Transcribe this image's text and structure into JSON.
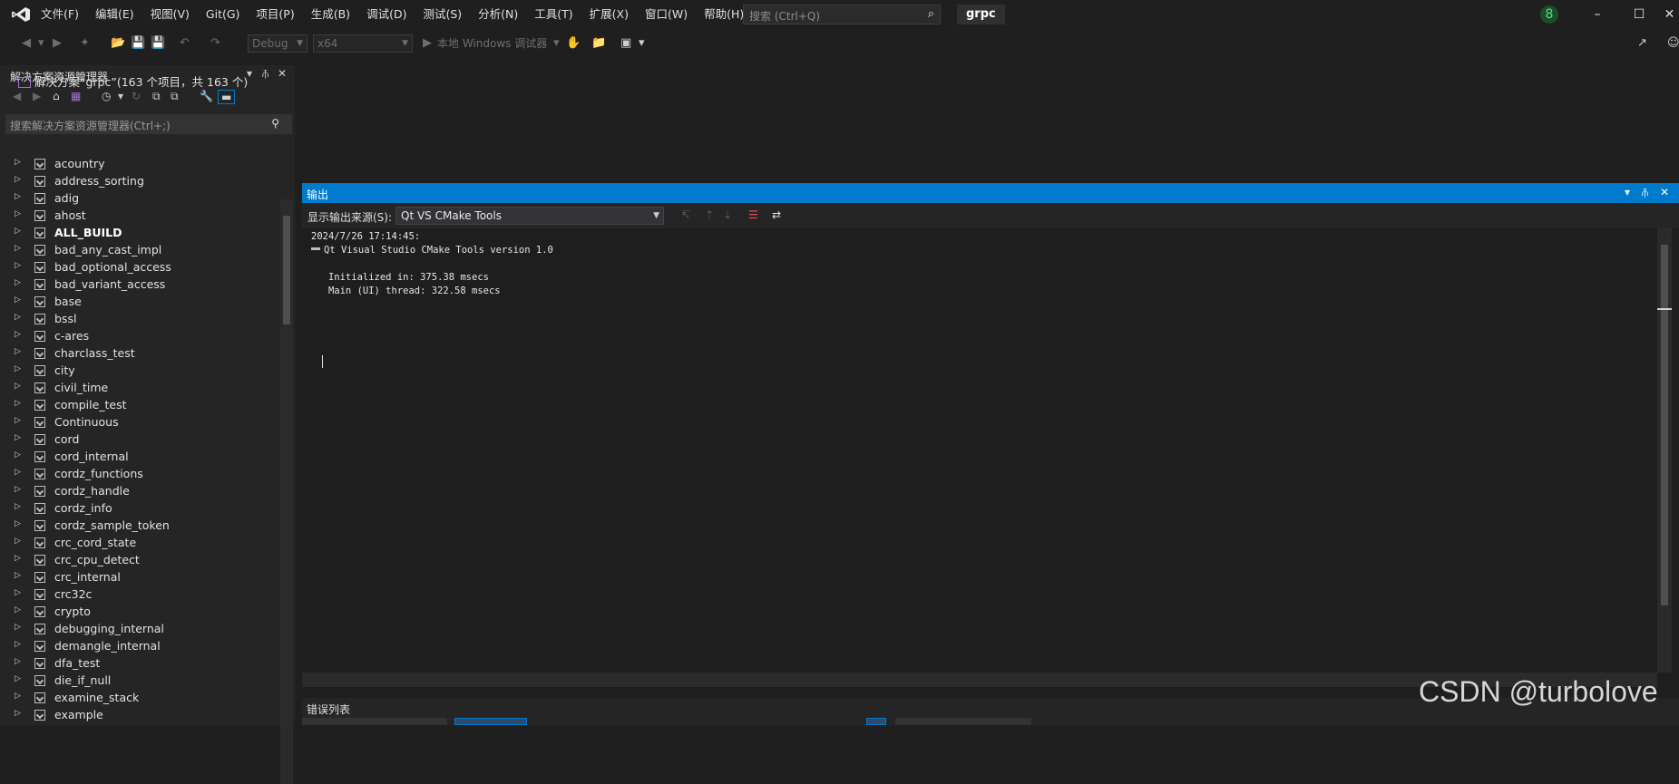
{
  "titlebar": {
    "menus": [
      "文件(F)",
      "编辑(E)",
      "视图(V)",
      "Git(G)",
      "项目(P)",
      "生成(B)",
      "调试(D)",
      "测试(S)",
      "分析(N)",
      "工具(T)",
      "扩展(X)",
      "窗口(W)",
      "帮助(H)"
    ],
    "search_placeholder": "搜索 (Ctrl+Q)",
    "solution_name": "grpc",
    "notification_count": "8"
  },
  "toolbar": {
    "config": "Debug",
    "platform": "x64",
    "run_target": "本地 Windows 调试器"
  },
  "solution_explorer": {
    "title": "解决方案资源管理器",
    "search_placeholder": "搜索解决方案资源管理器(Ctrl+;)",
    "solution_label": "解决方案“grpc”(163 个项目，共 163 个)",
    "projects": [
      "acountry",
      "address_sorting",
      "adig",
      "ahost",
      "ALL_BUILD",
      "bad_any_cast_impl",
      "bad_optional_access",
      "bad_variant_access",
      "base",
      "bssl",
      "c-ares",
      "charclass_test",
      "city",
      "civil_time",
      "compile_test",
      "Continuous",
      "cord",
      "cord_internal",
      "cordz_functions",
      "cordz_handle",
      "cordz_info",
      "cordz_sample_token",
      "crc_cord_state",
      "crc_cpu_detect",
      "crc_internal",
      "crc32c",
      "crypto",
      "debugging_internal",
      "demangle_internal",
      "dfa_test",
      "die_if_null",
      "examine_stack",
      "example"
    ],
    "bold_project": "ALL_BUILD"
  },
  "output": {
    "title": "输出",
    "source_label": "显示输出来源(S):",
    "source_value": "Qt VS CMake Tools",
    "lines": [
      "2024/7/26 17:14:45:",
      "Qt Visual Studio CMake Tools version 1.0",
      "",
      "   Initialized in: 375.38 msecs",
      "   Main (UI) thread: 322.58 msecs"
    ]
  },
  "error_list": {
    "title": "错误列表"
  },
  "watermark": "CSDN @turbolove",
  "colors": {
    "accent": "#007acc",
    "background": "#1f1f1f",
    "panel": "#252526"
  }
}
